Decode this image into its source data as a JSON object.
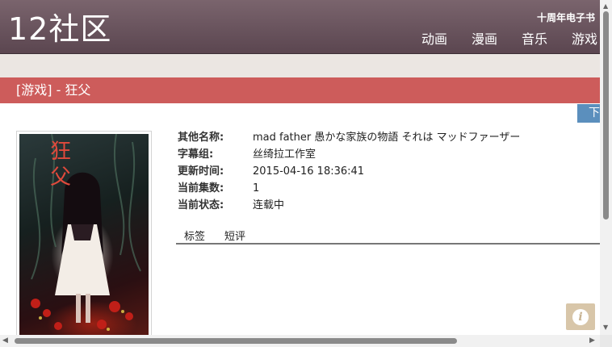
{
  "header": {
    "logo": "12社区",
    "tagline": "十周年电子书",
    "nav": [
      "动画",
      "漫画",
      "音乐",
      "游戏"
    ]
  },
  "title": "[游戏] - 狂父",
  "download_tab": "下",
  "details": [
    {
      "label": "其他名称:",
      "value": "mad father 愚かな家族の物語 それは マッドファーザー"
    },
    {
      "label": "字幕组:",
      "value": "丝绮拉工作室"
    },
    {
      "label": "更新时间:",
      "value": "2015-04-16 18:36:41"
    },
    {
      "label": "当前集数:",
      "value": "1"
    },
    {
      "label": "当前状态:",
      "value": "连载中"
    }
  ],
  "tabs": [
    "标签",
    "短评"
  ],
  "info_button": "i",
  "colors": {
    "header": "#6b5560",
    "title_bar": "#cd5c5b",
    "download_tab": "#5b8fbd",
    "subbar": "#ebe6e2"
  },
  "scroll": {
    "vertical_fraction": 0.62,
    "horizontal_fraction": 0.74
  }
}
